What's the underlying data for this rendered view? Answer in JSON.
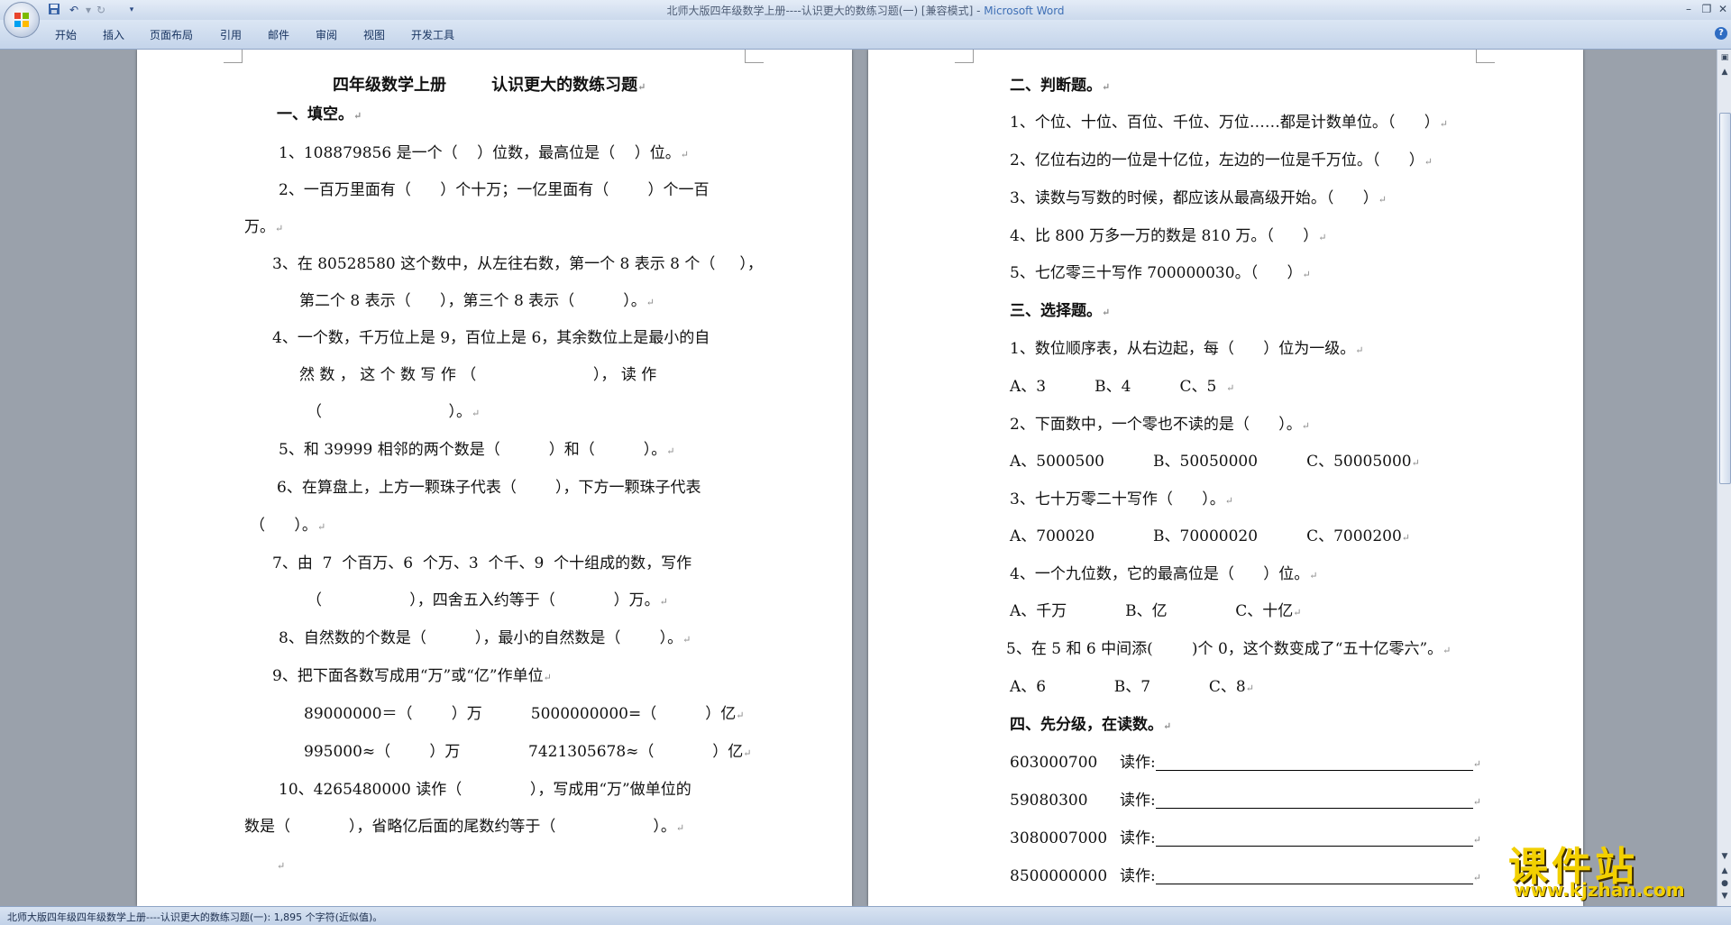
{
  "window": {
    "title_doc": "北师大版四年级数学上册----认识更大的数练习题(一) [兼容模式] - ",
    "title_app": "Microsoft Word",
    "qat": [
      "save-icon",
      "undo-icon",
      "redo-icon",
      "customize-icon"
    ]
  },
  "ribbon": {
    "tabs": [
      "开始",
      "插入",
      "页面布局",
      "引用",
      "邮件",
      "审阅",
      "视图",
      "开发工具"
    ]
  },
  "left_page": {
    "title": "四年级数学上册        认识更大的数练习题",
    "s1_heading": "一、填空。",
    "lines": [
      "1、108879856 是一个（    ）位数，最高位是（    ）位。",
      "2、一百万里面有（      ）个十万；一亿里面有（        ）个一百",
      "万。",
      "3、在 80528580 这个数中，从左往右数，第一个 8 表示 8 个（     ），",
      "第二个 8 表示（      ），第三个 8 表示（          ）。",
      "4、一个数，千万位上是 9，百位上是 6，其余数位上是最小的自",
      "然 数 ， 这 个 数 写 作 （                        ）， 读 作",
      "（                          ）。",
      "5、和 39999 相邻的两个数是（          ）和（          ）。",
      "6、在算盘上，上方一颗珠子代表（        ），下方一颗珠子代表",
      "（      ）。",
      "7、由  7  个百万、6  个万、3  个千、9  个十组成的数，写作",
      "（                  ），四舍五入约等于（            ）万。",
      "8、自然数的个数是（          ），最小的自然数是（        ）。",
      "9、把下面各数写成用“万”或“亿”作单位",
      "89000000＝（        ）万          5000000000=（          ）亿",
      "995000≈（        ）万              7421305678≈（            ）亿",
      "10、4265480000 读作（              ），写成用“万”做单位的",
      "数是（            ），省略亿后面的尾数约等于（                    ）。",
      ""
    ]
  },
  "right_page": {
    "s2_heading": "二、判断题。",
    "s2_lines": [
      "1、个位、十位、百位、千位、万位……都是计数单位。（      ）",
      "2、亿位右边的一位是十亿位，左边的一位是千万位。（      ）",
      "3、读数与写数的时候，都应该从最高级开始。（      ）",
      "4、比 800 万多一万的数是 810 万。（      ）",
      "5、七亿零三十写作 700000030。（      ）"
    ],
    "s3_heading": "三、选择题。",
    "s3_lines": [
      "1、数位顺序表，从右边起，每（      ）位为一级。",
      "A、3          B、4          C、5  ",
      "2、下面数中，一个零也不读的是（      ）。",
      "A、5000500          B、50050000          C、50005000",
      "3、七十万零二十写作（      ）。",
      "A、700020            B、70000020          C、7000200",
      "4、一个九位数，它的最高位是（      ）位。",
      "A、千万            B、亿              C、十亿",
      "5、在 5 和 6 中间添(        )个 0，这个数变成了“五十亿零六”。",
      "A、6              B、7            C、8"
    ],
    "s4_heading": "四、先分级，在读数。",
    "s4_items": [
      {
        "num": "603000700",
        "label": "读作:"
      },
      {
        "num": "59080300",
        "label": "读作:"
      },
      {
        "num": "3080007000",
        "label": "读作:"
      },
      {
        "num": "8500000000",
        "label": "读作:"
      }
    ]
  },
  "status": {
    "text": "北师大版四年级四年级数学上册----认识更大的数练习题(一): 1,895 个字符(近似值)。"
  },
  "watermark": {
    "title": "课件站",
    "url": "www.kjzhan.com"
  },
  "pilcrow": "↵"
}
